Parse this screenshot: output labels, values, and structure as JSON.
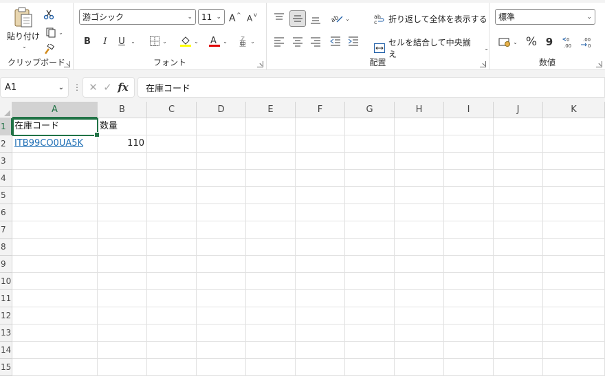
{
  "ribbon": {
    "clipboard": {
      "label": "クリップボード",
      "paste_label": "貼り付け"
    },
    "font": {
      "label": "フォント",
      "font_name": "游ゴシック",
      "font_size": "11",
      "bold": "B",
      "italic": "I",
      "underline": "U"
    },
    "alignment": {
      "label": "配置",
      "wrap_text": "折り返して全体を表示する",
      "merge_center": "セルを結合して中央揃え"
    },
    "number": {
      "label": "数値",
      "format": "標準",
      "percent": "%",
      "comma": "9"
    }
  },
  "formula_bar": {
    "name_box": "A1",
    "formula": "在庫コード",
    "fx": "fx"
  },
  "grid": {
    "columns": [
      "A",
      "B",
      "C",
      "D",
      "E",
      "F",
      "G",
      "H",
      "I",
      "J",
      "K"
    ],
    "rows": [
      "1",
      "2",
      "3",
      "4",
      "5",
      "6",
      "7",
      "8",
      "9",
      "10",
      "11",
      "12",
      "13",
      "14",
      "15"
    ],
    "cells": {
      "A1": "在庫コード",
      "B1": "数量",
      "A2": "ITB99CO0UA5K",
      "B2": "110"
    }
  },
  "colors": {
    "accent": "#217346",
    "link": "#1f6fb5",
    "fill_highlight": "#ffff00",
    "font_color": "#e00000"
  }
}
